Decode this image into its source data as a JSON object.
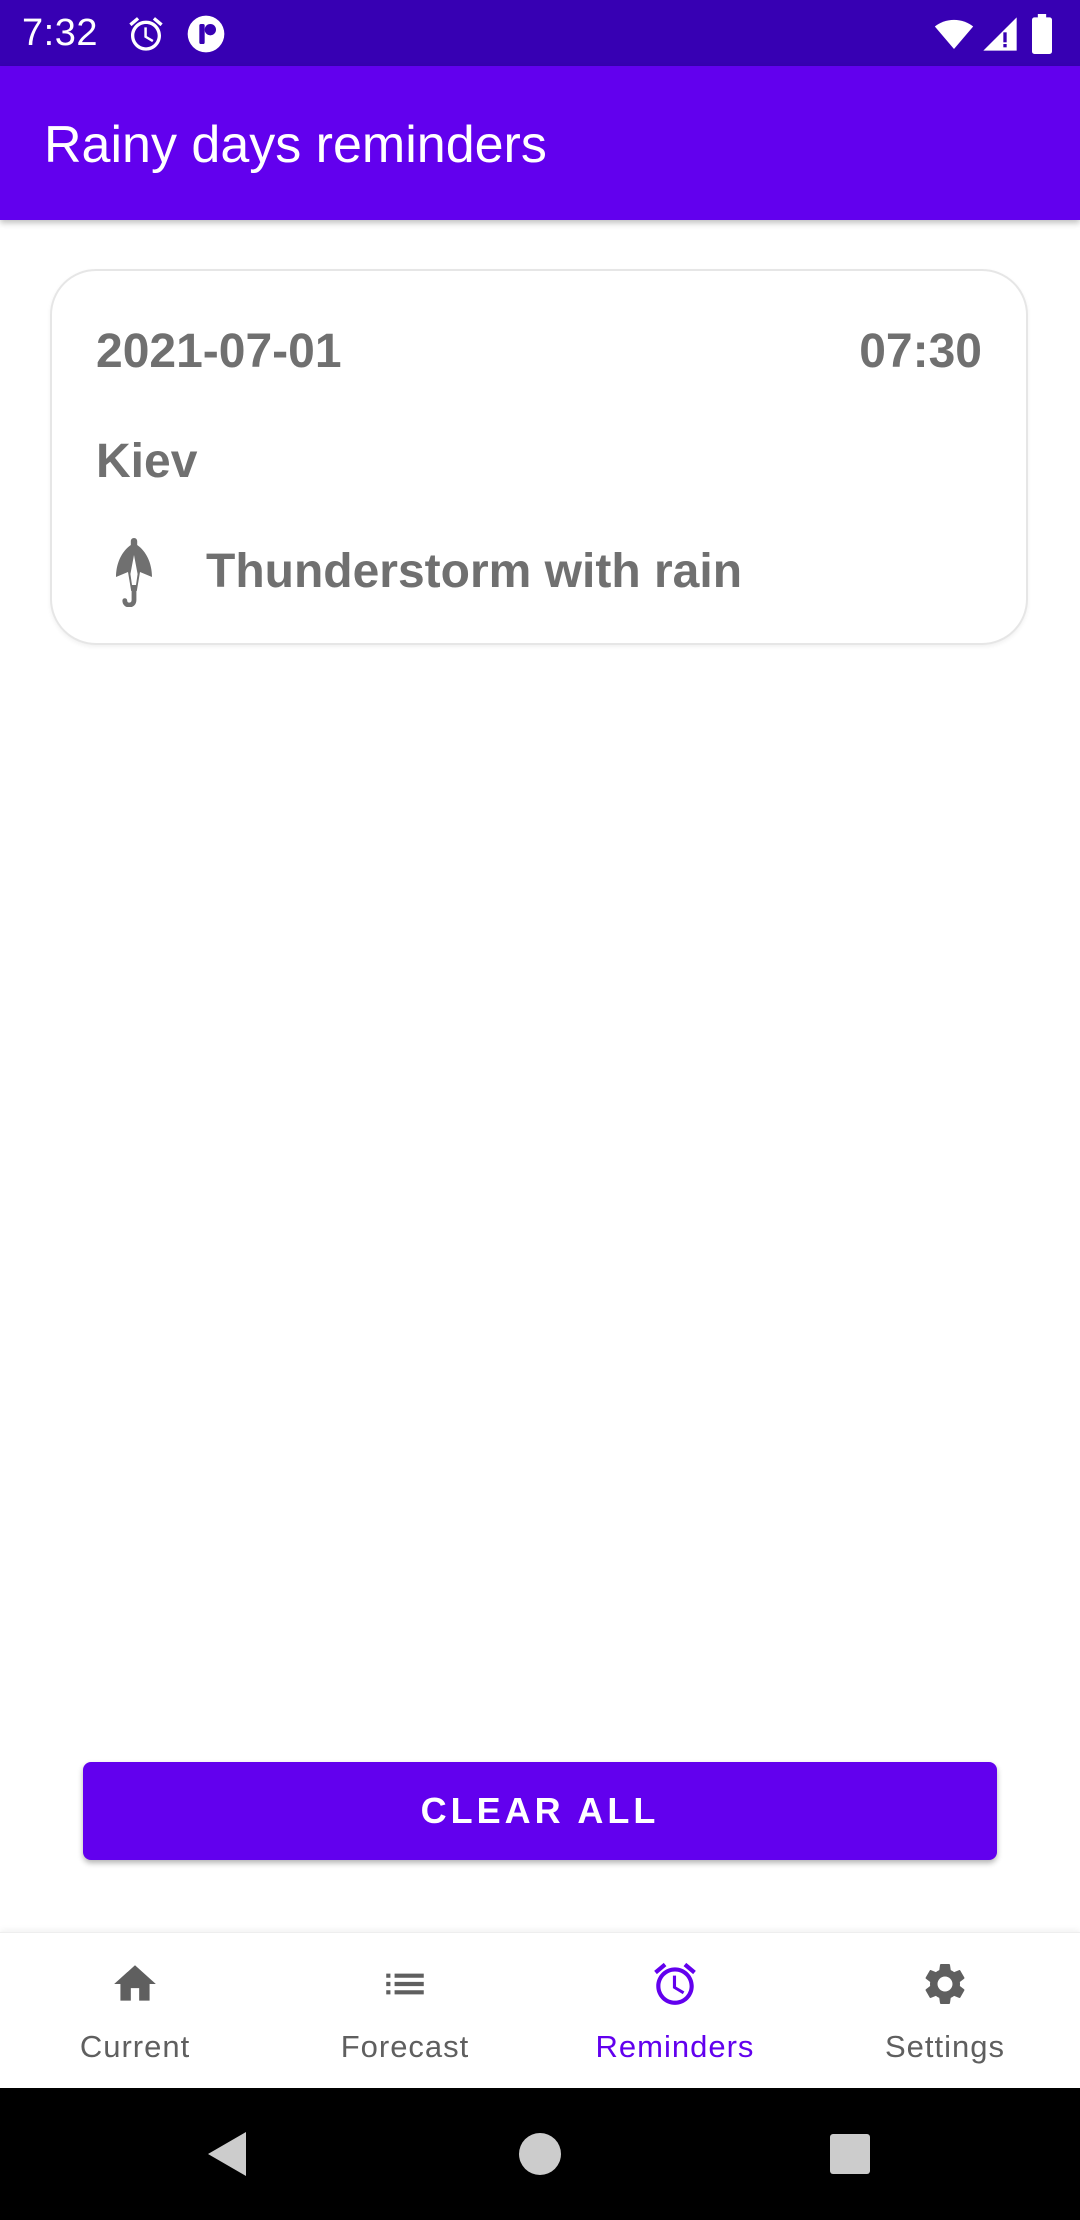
{
  "status_bar": {
    "time": "7:32",
    "icons": [
      "alarm-icon",
      "app-notification-icon",
      "wifi-icon",
      "cell-signal-icon",
      "battery-icon"
    ]
  },
  "app_bar": {
    "title": "Rainy days reminders"
  },
  "reminders": [
    {
      "date": "2021-07-01",
      "time": "07:30",
      "city": "Kiev",
      "weather": "Thunderstorm with rain",
      "icon": "umbrella-closed-icon"
    }
  ],
  "actions": {
    "clear_all_label": "CLEAR ALL"
  },
  "bottom_nav": {
    "items": [
      {
        "label": "Current",
        "icon": "home-icon",
        "active": false
      },
      {
        "label": "Forecast",
        "icon": "list-icon",
        "active": false
      },
      {
        "label": "Reminders",
        "icon": "alarm-icon",
        "active": true
      },
      {
        "label": "Settings",
        "icon": "gear-icon",
        "active": false
      }
    ]
  },
  "system_nav": {
    "icons": [
      "back-icon",
      "home-circle-icon",
      "recents-icon"
    ]
  },
  "colors": {
    "status_bar": "#3700B3",
    "primary": "#6200EE",
    "card_text": "#707070",
    "nav_inactive": "#5F5F5F",
    "nav_active": "#6200EE"
  }
}
